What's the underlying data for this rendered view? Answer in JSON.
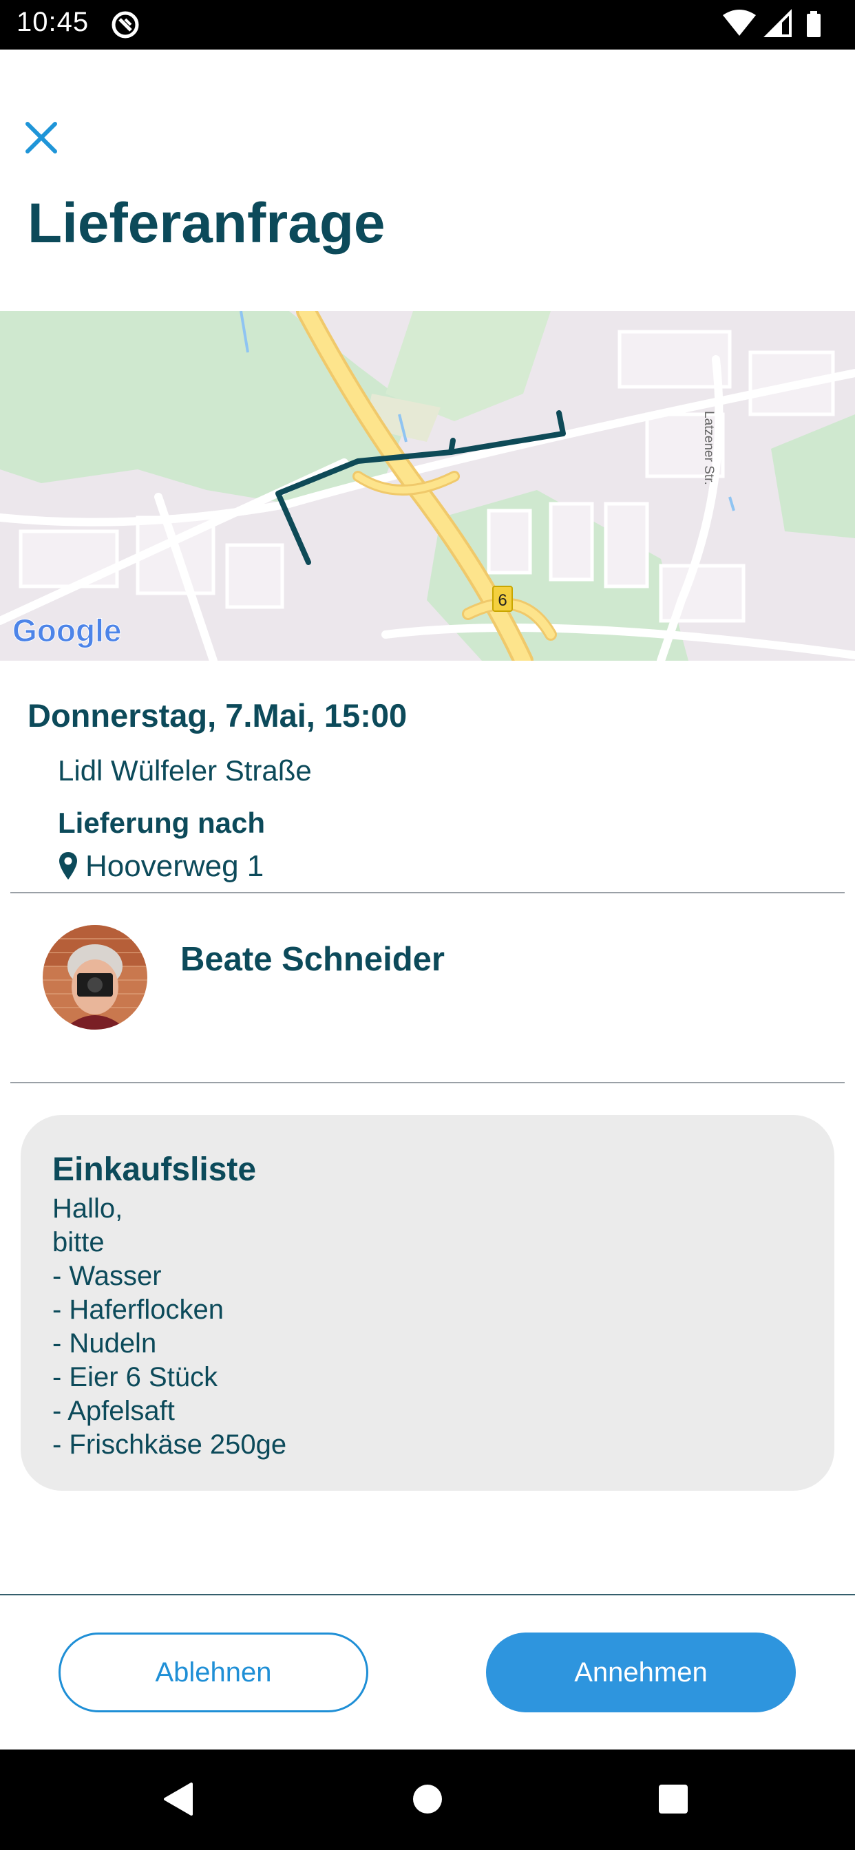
{
  "status_bar": {
    "time": "10:45"
  },
  "header": {
    "close_icon": "close-icon",
    "title": "Lieferanfrage"
  },
  "map": {
    "attribution": "Google",
    "road_shield": "6",
    "street_label": "Latzener Str."
  },
  "delivery": {
    "date_time": "Donnerstag, 7.Mai, 15:00",
    "store": "Lidl Wülfeler Straße",
    "delivery_label": "Lieferung nach",
    "address_icon": "location-pin-icon",
    "address": "Hooverweg 1"
  },
  "user": {
    "name": "Beate Schneider",
    "avatar_icon": "avatar"
  },
  "shopping_list": {
    "title": "Einkaufsliste",
    "lines": [
      "Hallo,",
      "bitte",
      "- Wasser",
      "- Haferflocken",
      "- Nudeln",
      "- Eier 6 Stück",
      "- Apfelsaft",
      "- Frischkäse 250ge"
    ]
  },
  "actions": {
    "decline_label": "Ablehnen",
    "accept_label": "Annehmen"
  },
  "colors": {
    "primary_text": "#0c4a5a",
    "accent": "#2e95de",
    "card_background": "#ebebeb",
    "route": "#0e4a57"
  },
  "navigation": {
    "back_icon": "back-icon",
    "home_icon": "home-icon",
    "recents_icon": "recents-icon"
  }
}
